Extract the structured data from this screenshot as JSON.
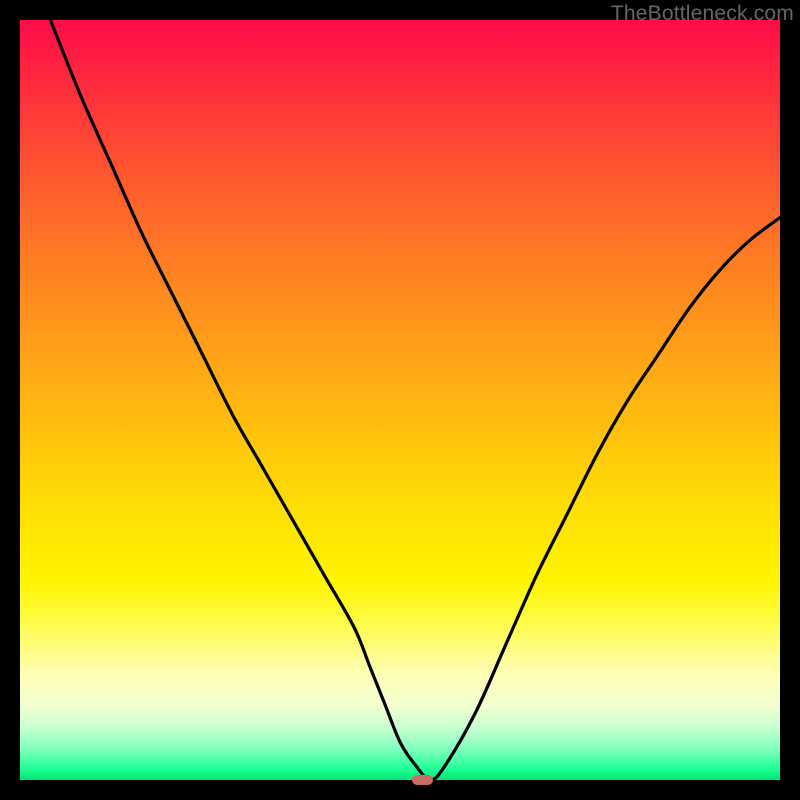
{
  "watermark": "TheBottleneck.com",
  "colors": {
    "frame": "#000000",
    "curve": "#000000",
    "marker": "#cc6b66"
  },
  "chart_data": {
    "type": "line",
    "title": "",
    "xlabel": "",
    "ylabel": "",
    "xlim": [
      0,
      100
    ],
    "ylim": [
      0,
      100
    ],
    "grid": false,
    "legend": false,
    "series": [
      {
        "name": "bottleneck-curve",
        "x": [
          4,
          8,
          12,
          16,
          20,
          24,
          28,
          32,
          36,
          40,
          44,
          46,
          48,
          50,
          52,
          54,
          56,
          60,
          64,
          68,
          72,
          76,
          80,
          84,
          88,
          92,
          96,
          100
        ],
        "values": [
          100,
          90,
          81,
          72,
          64,
          56,
          48,
          41,
          34,
          27,
          20,
          15,
          10,
          5,
          2,
          0,
          2,
          9,
          18,
          27,
          35,
          43,
          50,
          56,
          62,
          67,
          71,
          74
        ]
      }
    ],
    "marker": {
      "x": 53,
      "y": 0,
      "width_pct": 2.8,
      "height_pct": 1.3
    }
  }
}
